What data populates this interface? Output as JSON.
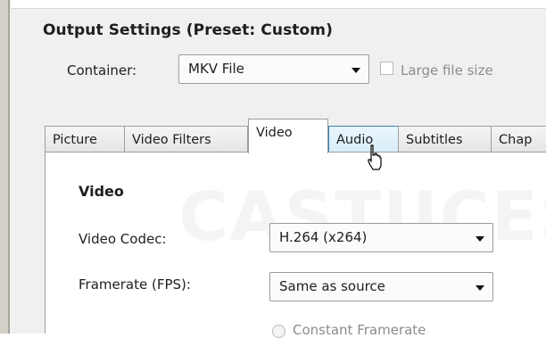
{
  "output_settings": {
    "title": "Output Settings (Preset: Custom)",
    "container_label": "Container:",
    "container_value": "MKV File",
    "large_file_label": "Large file size"
  },
  "tabs": [
    {
      "label": "Picture"
    },
    {
      "label": "Video Filters"
    },
    {
      "label": "Video"
    },
    {
      "label": "Audio"
    },
    {
      "label": "Subtitles"
    },
    {
      "label": "Chap"
    }
  ],
  "video_panel": {
    "title": "Video",
    "codec_label": "Video Codec:",
    "codec_value": "H.264 (x264)",
    "framerate_label": "Framerate (FPS):",
    "framerate_value": "Same as source",
    "constant_framerate_label": "Constant Framerate"
  },
  "watermark": "CASTUCES",
  "colors": {
    "tab_hover_border": "#3c7fb1",
    "window_bg": "#f0f0f0"
  },
  "icons": [
    "dropdown-arrow-icon",
    "mouse-pointer-icon"
  ]
}
